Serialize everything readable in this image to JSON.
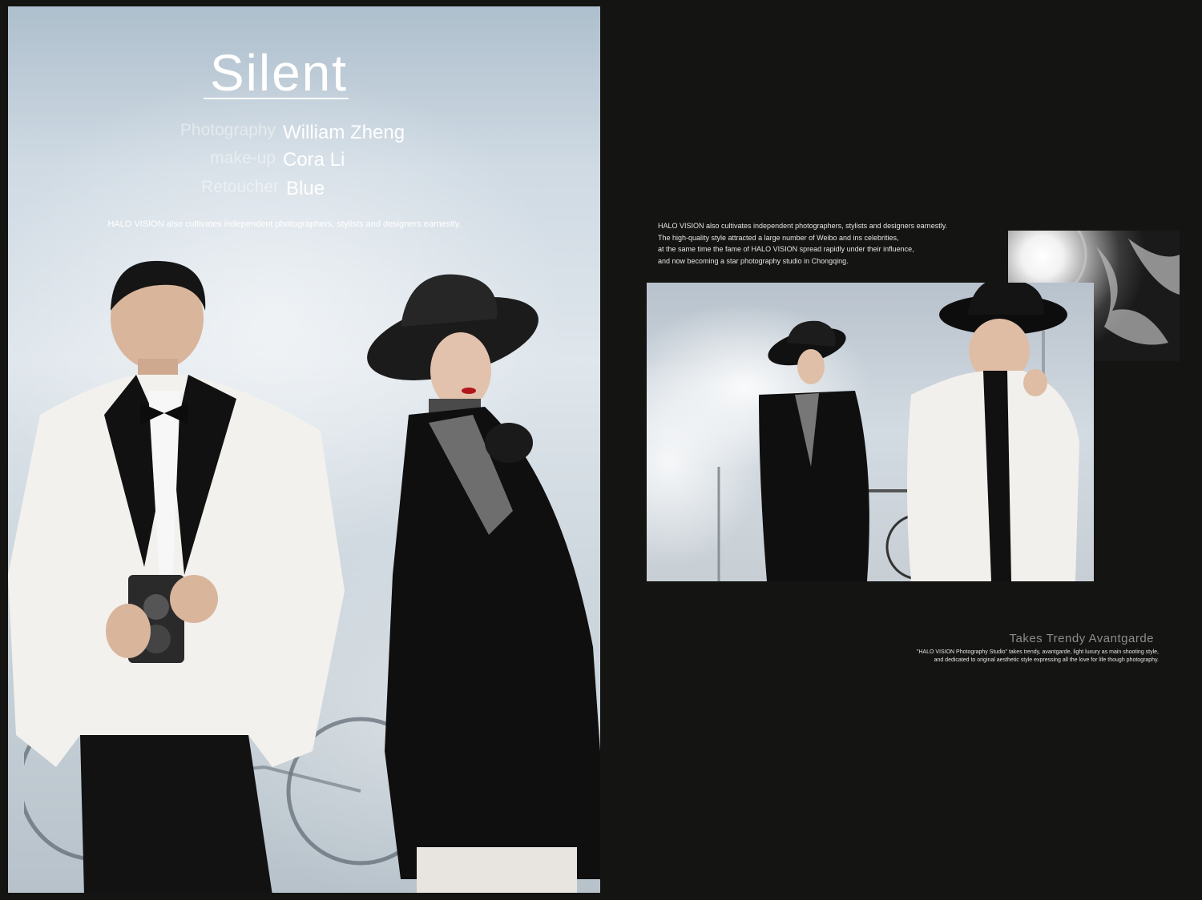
{
  "poster": {
    "title": "Silent",
    "credits": [
      {
        "role": "Photography",
        "name": "William Zheng"
      },
      {
        "role": "make-up",
        "name": "Cora Li"
      },
      {
        "role": "Retoucher",
        "name": "Blue"
      }
    ],
    "tagline": "HALO VISION also cultivates independent photographers, stylists and designers earnestly."
  },
  "story": {
    "lines": [
      "HALO VISION also cultivates independent photographers, stylists and designers earnestly.",
      "The high-quality style attracted a large number of Weibo and ins celebrities,",
      "at the same time the fame of HALO VISION spread rapidly under their influence,",
      "and now becoming a star photography studio in Chongqing."
    ]
  },
  "feature": {
    "heading": "Takes Trendy Avantgarde",
    "caption_lines": [
      "\"HALO VISION Photography Studio\" takes trendy, avantgarde,  light luxury as main shooting style,",
      "and dedicated to original aesthetic style expressing all the love for life though photography."
    ]
  }
}
